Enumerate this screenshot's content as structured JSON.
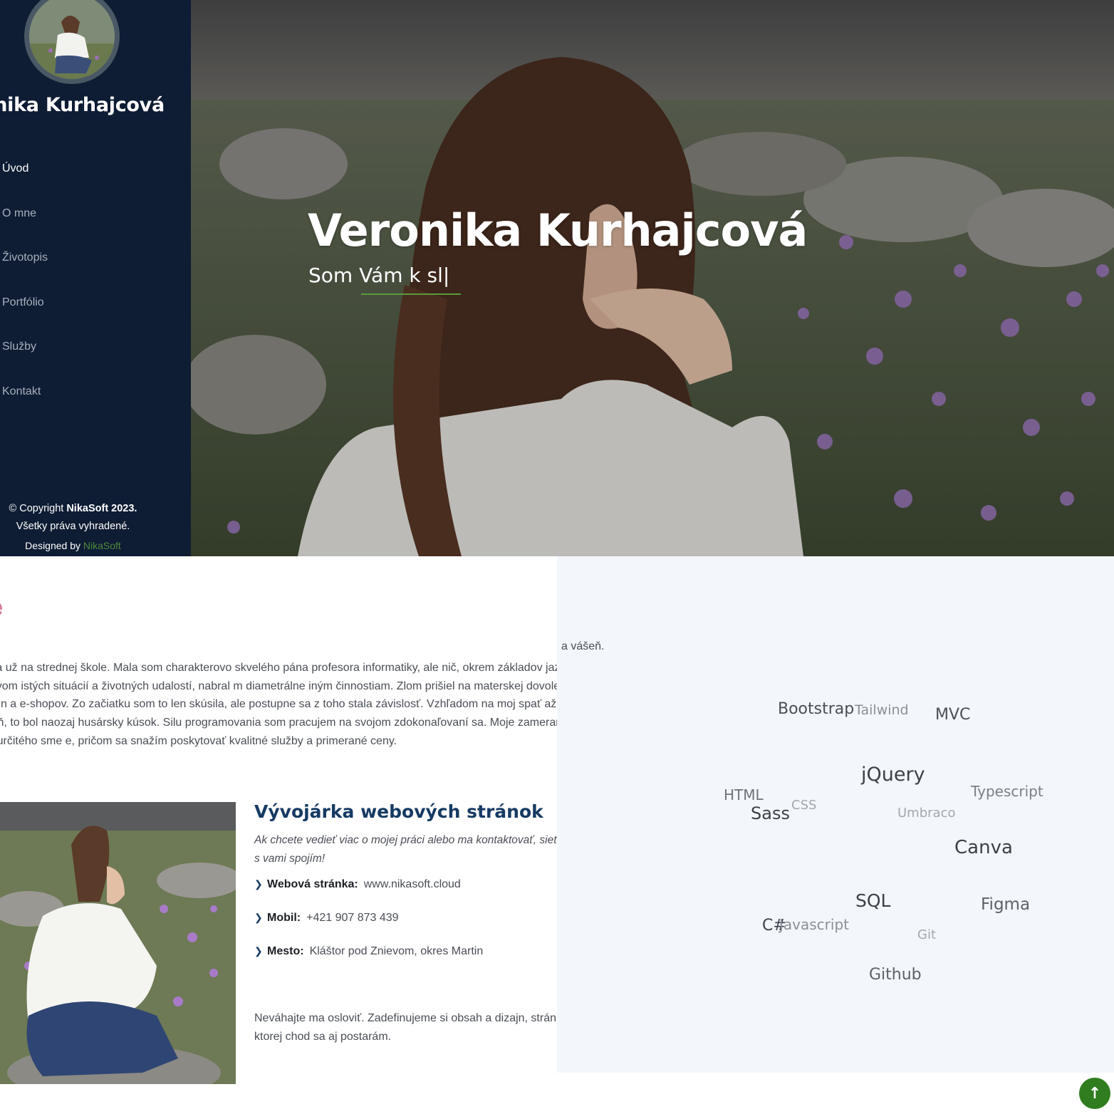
{
  "sidebar": {
    "name": "ronika Kurhajcová",
    "nav": [
      {
        "label": "Úvod",
        "active": true
      },
      {
        "label": "O mne",
        "active": false
      },
      {
        "label": "Životopis",
        "active": false
      },
      {
        "label": "Portfólio",
        "active": false
      },
      {
        "label": "Služby",
        "active": false
      },
      {
        "label": "Kontakt",
        "active": false
      }
    ],
    "footer": {
      "copyright_prefix": "© Copyright ",
      "copyright_brand": "NikaSoft 2023.",
      "rights": "Všetky práva vyhradené.",
      "designed_by": "Designed by ",
      "designer": "NikaSoft"
    }
  },
  "hero": {
    "title": "Veronika Kurhajcová",
    "subtitle": "Som Vám k sl|"
  },
  "about": {
    "heading": "ne",
    "paragraph": "Cesta k IT začala už na strednej škole. Mala som charakterovo skvelého pána profesora informatiky, ale nič, okrem základov jazyka pascal. Neskôr pod vplyvom istých situácií a životných udalostí, nabral m diametrálne iným činnostiam. Zlom prišiel na materskej dovolenke. Moja známa mi odporučila jedn a e-shopov. Zo začiatku som to len skúsila, ale postupne sa z toho stala závislosť. Vzhľadom na moj spať až neuveriteľných 6-8 hodín za celý deň, to bol naozaj husársky kúsok. Silu programovania som pracujem na svojom zdokonaľovaní sa. Moje zameranie sa postupne vyprofilovalo do určitého sme e, pričom sa snažím poskytovať kvalitné služby a primerané ceny.",
    "overflow_text": "a vášeň.",
    "role_title": "Vývojárka webových stránok",
    "role_desc": "Ak chcete vedieť viac o mojej práci alebo ma kontaktovať, siete. Rada sa s vami spojím!",
    "info": [
      {
        "label": "Webová stránka:",
        "value": "www.nikasoft.cloud"
      },
      {
        "label": "Mobil:",
        "value": "+421 907 873 439"
      },
      {
        "label": "Mesto:",
        "value": "Kláštor pod Znievom, okres Martin"
      }
    ],
    "closing": "Neváhajte ma osloviť. Zadefinujeme si obsah a dizajn, stránku, o ktorej chod sa aj postarám."
  },
  "skills": [
    {
      "label": "Bootstrap",
      "color": "#4a4f57"
    },
    {
      "label": "Tailwind",
      "color": "#8b9098"
    },
    {
      "label": "MVC",
      "color": "#4a4f57"
    },
    {
      "label": "jQuery",
      "color": "#3c4149"
    },
    {
      "label": "HTML",
      "color": "#6f747c"
    },
    {
      "label": "CSS",
      "color": "#a3a8ae"
    },
    {
      "label": "Sass",
      "color": "#3c4149"
    },
    {
      "label": "Typescript",
      "color": "#7b8087"
    },
    {
      "label": "Umbraco",
      "color": "#a3a8ae"
    },
    {
      "label": "Canva",
      "color": "#3c4149"
    },
    {
      "label": "SQL",
      "color": "#3c4149"
    },
    {
      "label": "Figma",
      "color": "#5d6269"
    },
    {
      "label": "C#",
      "color": "#3c4149"
    },
    {
      "label": "Javascript",
      "color": "#8b9098"
    },
    {
      "label": "Git",
      "color": "#a3a8ae"
    },
    {
      "label": "Github",
      "color": "#5d6269"
    }
  ],
  "back_to_top_icon": "arrow-up-icon"
}
